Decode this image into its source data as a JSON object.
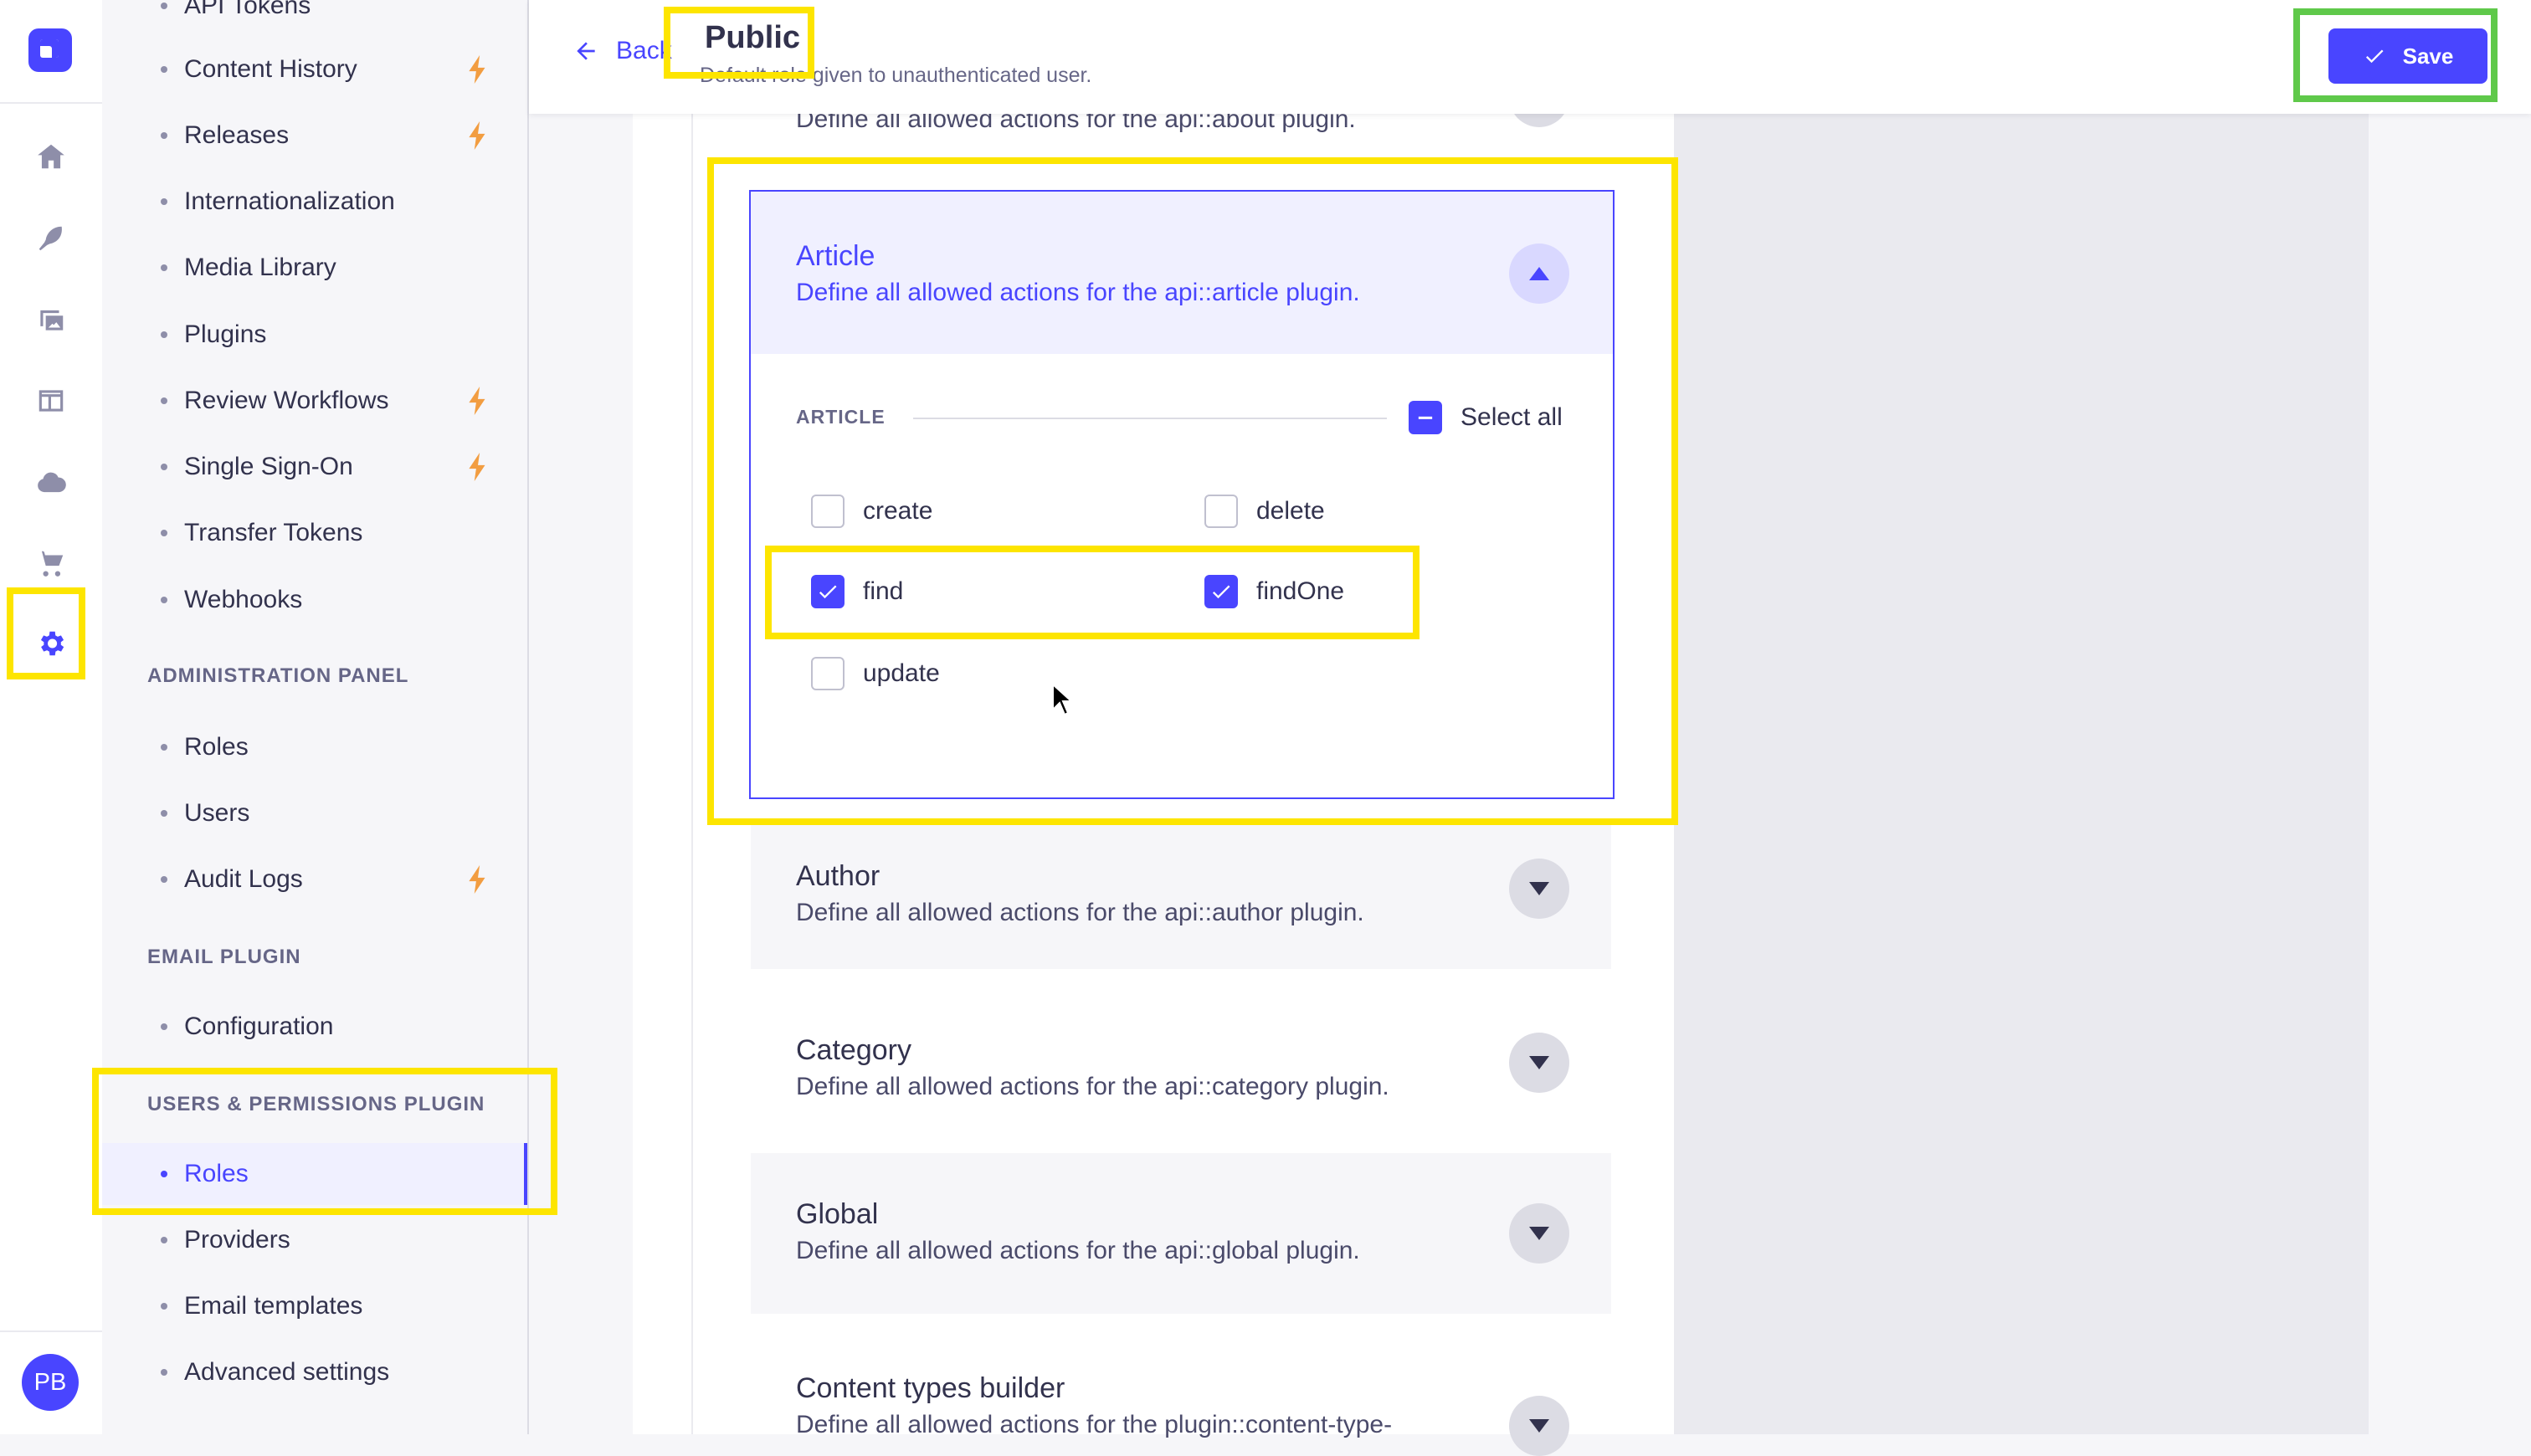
{
  "sidebar_nav": {
    "items": [
      {
        "label": "API Tokens",
        "bolt": false
      },
      {
        "label": "Content History",
        "bolt": true
      },
      {
        "label": "Releases",
        "bolt": true
      },
      {
        "label": "Internationalization",
        "bolt": false
      },
      {
        "label": "Media Library",
        "bolt": false
      },
      {
        "label": "Plugins",
        "bolt": false
      },
      {
        "label": "Review Workflows",
        "bolt": true
      },
      {
        "label": "Single Sign-On",
        "bolt": true
      },
      {
        "label": "Transfer Tokens",
        "bolt": false
      },
      {
        "label": "Webhooks",
        "bolt": false
      }
    ],
    "admin_heading": "ADMINISTRATION PANEL",
    "admin_items": [
      {
        "label": "Roles",
        "bolt": false
      },
      {
        "label": "Users",
        "bolt": false
      },
      {
        "label": "Audit Logs",
        "bolt": true
      }
    ],
    "email_heading": "EMAIL PLUGIN",
    "email_items": [
      {
        "label": "Configuration"
      }
    ],
    "up_heading": "USERS & PERMISSIONS PLUGIN",
    "up_items": [
      {
        "label": "Roles",
        "active": true
      },
      {
        "label": "Providers"
      },
      {
        "label": "Email templates"
      },
      {
        "label": "Advanced settings"
      }
    ]
  },
  "rail": {
    "icons": [
      "home-icon",
      "feather-icon",
      "media-icon",
      "layout-icon",
      "cloud-icon",
      "cart-icon",
      "settings-icon"
    ],
    "avatar_initials": "PB"
  },
  "header": {
    "back_label": "Back",
    "title": "Public",
    "subtitle": "Default role given to unauthenticated user.",
    "save_label": "Save"
  },
  "accordions": {
    "about": {
      "desc": "Define all allowed actions for the api::about plugin."
    },
    "article": {
      "name": "Article",
      "desc": "Define all allowed actions for the api::article plugin.",
      "section_label": "ARTICLE",
      "select_all_label": "Select all",
      "permissions": [
        {
          "label": "create",
          "checked": false
        },
        {
          "label": "delete",
          "checked": false
        },
        {
          "label": "find",
          "checked": true
        },
        {
          "label": "findOne",
          "checked": true
        },
        {
          "label": "update",
          "checked": false
        }
      ]
    },
    "author": {
      "name": "Author",
      "desc": "Define all allowed actions for the api::author plugin."
    },
    "category": {
      "name": "Category",
      "desc": "Define all allowed actions for the api::category plugin."
    },
    "global": {
      "name": "Global",
      "desc": "Define all allowed actions for the api::global plugin."
    },
    "ctb": {
      "name": "Content types builder",
      "desc": "Define all allowed actions for the plugin::content-type-"
    }
  },
  "colors": {
    "accent": "#4945ff",
    "highlight_yellow": "#fde500",
    "highlight_green": "#5fc94a",
    "bolt": "#f29d41"
  }
}
